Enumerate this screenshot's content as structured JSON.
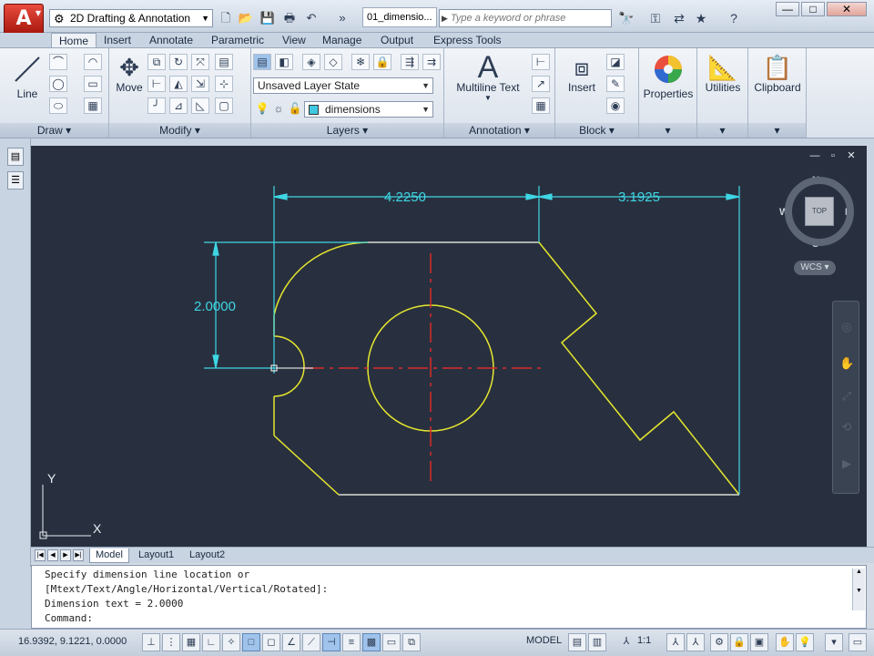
{
  "titlebar": {
    "app_button_glyph": "A",
    "workspace": "2D Drafting & Annotation",
    "document_tab": "01_dimensio...",
    "search_placeholder": "Type a keyword or phrase",
    "window_buttons": [
      "—",
      "□",
      "✕"
    ]
  },
  "ribbon_tabs": [
    "Home",
    "Insert",
    "Annotate",
    "Parametric",
    "View",
    "Manage",
    "Output",
    "Express Tools"
  ],
  "panels": {
    "draw": {
      "title": "Draw",
      "line_label": "Line"
    },
    "modify": {
      "title": "Modify",
      "move_label": "Move"
    },
    "layers": {
      "title": "Layers",
      "layer_state": "Unsaved Layer State",
      "current_layer": "dimensions"
    },
    "annotation": {
      "title": "Annotation",
      "mtext_label": "Multiline Text",
      "mtext_glyph": "A"
    },
    "block": {
      "title": "Block",
      "insert_label": "Insert"
    },
    "properties_label": "Properties",
    "utilities_label": "Utilities",
    "clipboard_label": "Clipboard"
  },
  "canvas": {
    "dimensions": {
      "top_left": "4.2250",
      "top_right": "3.1925",
      "left_vertical": "2.0000"
    },
    "ucs": {
      "x": "X",
      "y": "Y"
    },
    "viewcube": {
      "n": "N",
      "s": "S",
      "e": "E",
      "w": "W",
      "face": "TOP",
      "wcs": "WCS"
    },
    "viewport_controls": [
      "—",
      "▫",
      "✕"
    ]
  },
  "layout_tabs": [
    "Model",
    "Layout1",
    "Layout2"
  ],
  "command_lines": [
    "Specify dimension line location or",
    "[Mtext/Text/Angle/Horizontal/Vertical/Rotated]:",
    "Dimension text = 2.0000",
    "Command:"
  ],
  "statusbar": {
    "coordinates": "16.9392, 9.1221, 0.0000",
    "model": "MODEL",
    "annotation_scale": "1:1"
  },
  "colors": {
    "canvas_bg": "#28303f",
    "geometry": "#e6e62e",
    "dimension": "#3fd6e4",
    "centerline": "#d82a2a"
  }
}
